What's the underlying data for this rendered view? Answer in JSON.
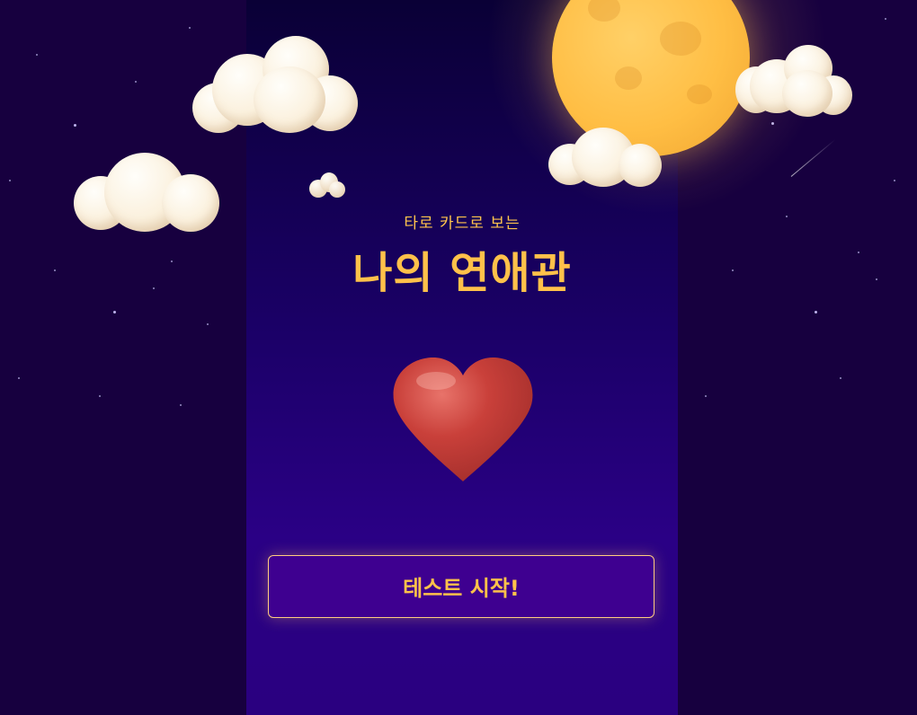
{
  "header": {
    "subtitle": "타로 카드로 보는",
    "title": "나의 연애관"
  },
  "actions": {
    "start_label": "테스트 시작!"
  },
  "icons": {
    "hero": "heart-icon",
    "sky": [
      "moon-icon",
      "cloud-icon"
    ]
  },
  "colors": {
    "background": "#17003f",
    "panel": "#2a0085",
    "accent": "#ffc14a",
    "button": "#3e0090",
    "heart": "#c9403a",
    "moon": "#ffbe44"
  }
}
